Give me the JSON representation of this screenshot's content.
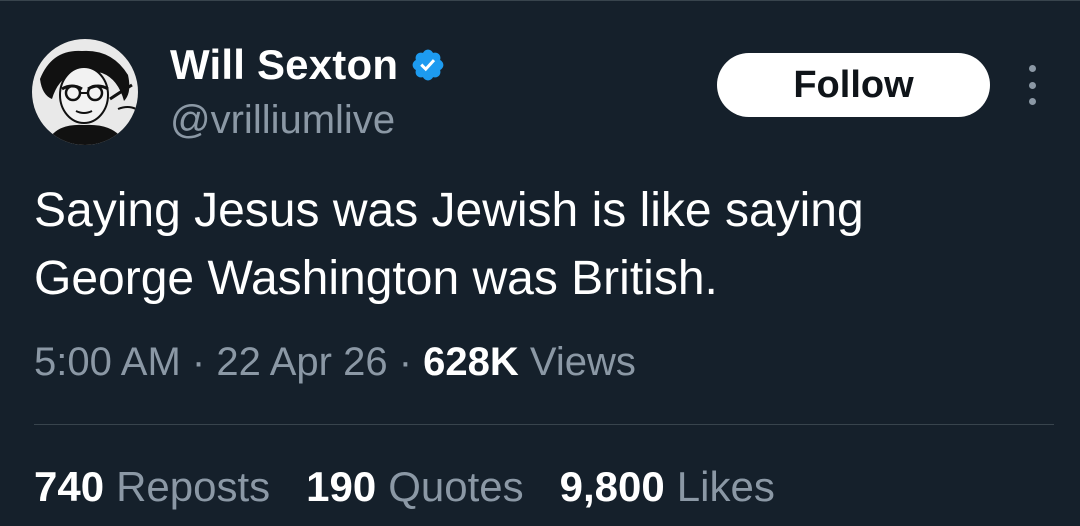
{
  "author": {
    "name": "Will Sexton",
    "handle": "@vrilliumlive",
    "verified": true,
    "verified_color": "#1d9bf0"
  },
  "follow_label": "Follow",
  "more_icon": "more-vertical-icon",
  "tweet": {
    "text_line1": "Saying Jesus was Jewish is like saying",
    "text_line2": "George Washington was British.",
    "time": "5:00 AM",
    "separator": "·",
    "date": "22 Apr 26",
    "views_count": "628K",
    "views_label": "Views"
  },
  "stats": [
    {
      "count": "740",
      "label": "Reposts"
    },
    {
      "count": "190",
      "label": "Quotes"
    },
    {
      "count": "9,800",
      "label": "Likes"
    }
  ],
  "colors": {
    "background": "#15202b",
    "secondary_text": "#8b98a5",
    "divider": "#38444d"
  }
}
